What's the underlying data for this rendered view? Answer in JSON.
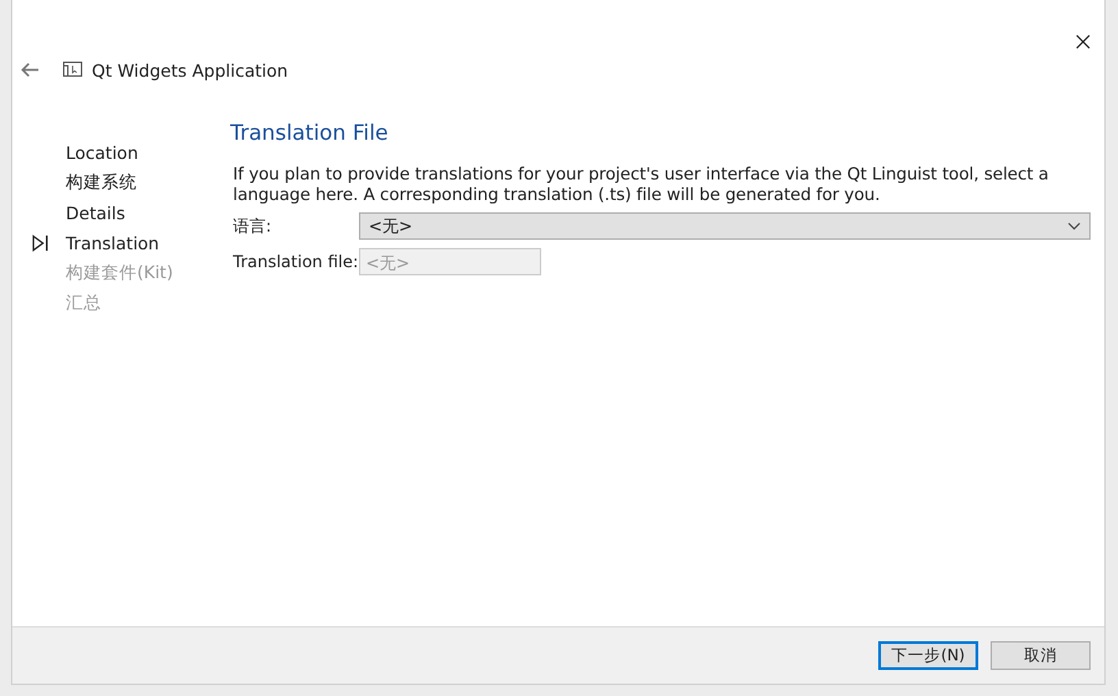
{
  "window": {
    "title": "Qt Widgets Application"
  },
  "steps": [
    {
      "label": "Location",
      "disabled": false,
      "selected": false
    },
    {
      "label": "构建系统",
      "disabled": false,
      "selected": false
    },
    {
      "label": "Details",
      "disabled": false,
      "selected": false
    },
    {
      "label": "Translation",
      "disabled": false,
      "selected": true
    },
    {
      "label": "构建套件(Kit)",
      "disabled": true,
      "selected": false
    },
    {
      "label": "汇总",
      "disabled": true,
      "selected": false
    }
  ],
  "page": {
    "title": "Translation File",
    "description": "If you plan to provide translations for your project's user interface via the Qt Linguist tool, select a language here. A corresponding translation (.ts) file will be generated for you.",
    "fields": [
      {
        "label": "语言:",
        "kind": "dropdown",
        "value": "<无>",
        "disabled": false
      },
      {
        "label": "Translation file:",
        "kind": "text",
        "value": "<无>",
        "disabled": true
      }
    ]
  },
  "buttons": [
    {
      "label": "下一步(N)",
      "default": true
    },
    {
      "label": "取消",
      "default": false
    }
  ]
}
